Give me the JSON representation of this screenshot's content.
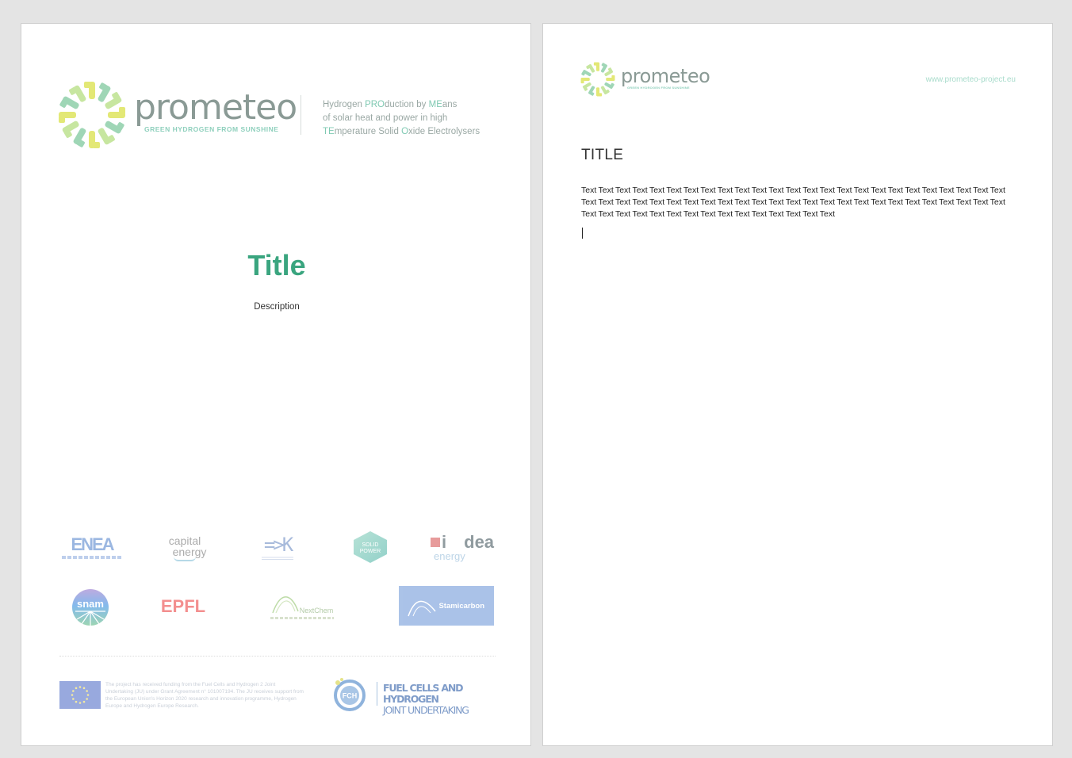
{
  "cover": {
    "brand": {
      "name": "prometeo",
      "subtitle": "GREEN HYDROGEN FROM SUNSHINE"
    },
    "tagline": {
      "line1": [
        {
          "text": "Hydrogen ",
          "highlight": false
        },
        {
          "text": "PRO",
          "highlight": true
        },
        {
          "text": "duction by ",
          "highlight": false
        },
        {
          "text": "ME",
          "highlight": true
        },
        {
          "text": "ans",
          "highlight": false
        }
      ],
      "line2": [
        {
          "text": "of solar heat and power in high",
          "highlight": false
        }
      ],
      "line3": [
        {
          "text": "TE",
          "highlight": true
        },
        {
          "text": "mperature Solid ",
          "highlight": false
        },
        {
          "text": "O",
          "highlight": true
        },
        {
          "text": "xide Electrolysers",
          "highlight": false
        }
      ]
    },
    "title": "Title",
    "description": "Description",
    "partners": {
      "enea": "ENEA",
      "capital_1": "capital",
      "capital_2": "energy",
      "fbk": "=>K",
      "solid_power_1": "SOLID",
      "solid_power_2": "POWER",
      "idea_prefix": "i",
      "idea_word": "dea",
      "idea_energy": "energy",
      "snam": "snam",
      "epfl": "EPFL",
      "nextchem": "NextChem",
      "stamicarbon": "Stamicarbon"
    },
    "footer": {
      "funding_text": "The project has received funding from the Fuel Cells and Hydrogen 2 Joint Undertaking (JU) under Grant Agreement n° 101007194. The JU receives support from the European Union's Horizon 2020 research and innovation programme, Hydrogen Europe and Hydrogen Europe Research.",
      "fch_badge": "FCH",
      "fch_line1": "FUEL CELLS AND HYDROGEN",
      "fch_line2": "JOINT UNDERTAKING"
    }
  },
  "content_page": {
    "brand": {
      "name": "prometeo",
      "subtitle": "GREEN HYDROGEN FROM SUNSHINE"
    },
    "url": "www.prometeo-project.eu",
    "title": "TITLE",
    "body": "Text Text Text Text Text Text Text Text Text Text Text Text Text Text Text Text Text Text Text Text Text Text Text Text Text Text Text Text Text Text Text Text Text Text Text Text Text Text Text Text Text Text Text Text Text Text Text Text Text Text Text Text Text Text Text Text Text Text Text Text Text Text Text Text Text"
  },
  "colors": {
    "title_green": "#3aa57f",
    "brand_grey": "#8a9a95",
    "accent_teal": "#8fd0bd",
    "sun_yellow": "#e3e876",
    "sun_green": "#9fd6b6"
  }
}
